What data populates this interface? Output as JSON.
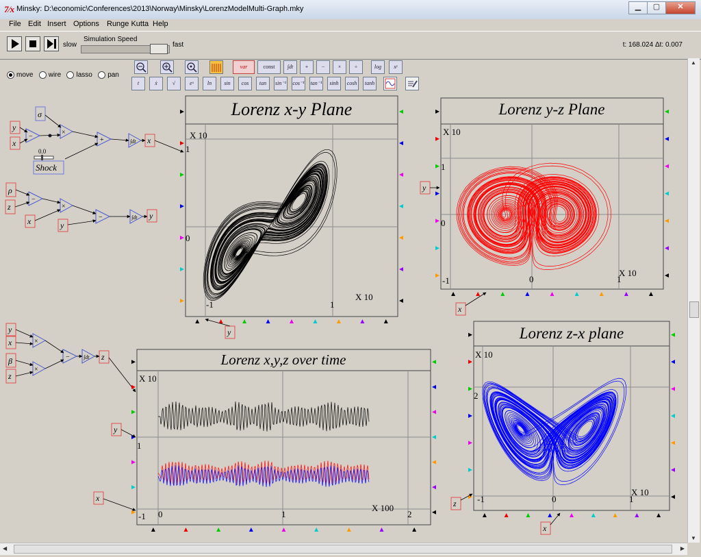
{
  "window": {
    "title": "Minsky: D:\\economic\\Conferences\\2013\\Norway\\Minsky\\LorenzModelMulti-Graph.mky",
    "icon_text": "7⁄x"
  },
  "menu": [
    "File",
    "Edit",
    "Insert",
    "Options",
    "Runge Kutta",
    "Help"
  ],
  "toolbar": {
    "slow_label": "slow",
    "fast_label": "fast",
    "speed_label": "Simulation Speed",
    "status": "t: 168.024 Δt: 0.007"
  },
  "modes": [
    "move",
    "wire",
    "lasso",
    "pan"
  ],
  "selected_mode": "move",
  "palette_row1": [
    "zoom-out",
    "zoom-in",
    "zoom-fit",
    "plot",
    "var",
    "const",
    "integrate",
    "add",
    "subtract",
    "multiply",
    "divide",
    "log",
    "pow"
  ],
  "palette_row1_labels": {
    "var": "var",
    "const": "const",
    "integrate": "∫dt",
    "log": "log",
    "pow": "xʸ"
  },
  "palette_row2": [
    "time",
    "deriv",
    "sqrt",
    "exp",
    "ln",
    "sin",
    "cos",
    "tan",
    "asin",
    "acos",
    "atan",
    "sinh",
    "cosh",
    "tanh"
  ],
  "palette_row2_labels": [
    "t",
    "ẋ",
    "√",
    "eˣ",
    "ln",
    "sin",
    "cos",
    "tan",
    "sin⁻¹",
    "cos⁻¹",
    "tan⁻¹",
    "sinh",
    "cosh",
    "tanh"
  ],
  "shock": {
    "label": "Shock",
    "value": "0.0"
  },
  "vars": {
    "sigma": "σ",
    "rho": "ρ",
    "beta": "β",
    "x": "x",
    "y": "y",
    "z": "z",
    "integral": "∫dt"
  },
  "plots": {
    "xy": {
      "title": "Lorenz x-y Plane",
      "scale_top": "X 10",
      "scale_bottom": "X 10",
      "ytick_hi": "1",
      "ytick_zero": "0",
      "xtick_lo": "-1",
      "xtick_hi": "1"
    },
    "yz": {
      "title": "Lorenz y-z Plane",
      "scale_top": "X 10",
      "scale_bottom": "X 10",
      "ytick_hi": "1",
      "ytick_zero": "0",
      "xtick_lo": "-1",
      "xtick_zero": "0",
      "xtick_hi": "1"
    },
    "time": {
      "title": "Lorenz x,y,z over time",
      "scale_top": "X 10",
      "scale_bottom": "X 100",
      "ytick_hi": "1",
      "xtick_lo": "-1",
      "xtick_zero": "0",
      "xtick_1": "1",
      "xtick_2": "2"
    },
    "zx": {
      "title": "Lorenz z-x plane",
      "scale_top": "X 10",
      "scale_bottom": "X 10",
      "ytick_hi": "2",
      "xtick_lo": "-1",
      "xtick_zero": "0",
      "xtick_hi": "1"
    }
  },
  "colors": {
    "x_series": "#000000",
    "y_series": "#ff0000",
    "z_series": "#0000ff",
    "wire": "#000000",
    "op_border": "#4a5ad0",
    "var_border": "#e04040"
  }
}
